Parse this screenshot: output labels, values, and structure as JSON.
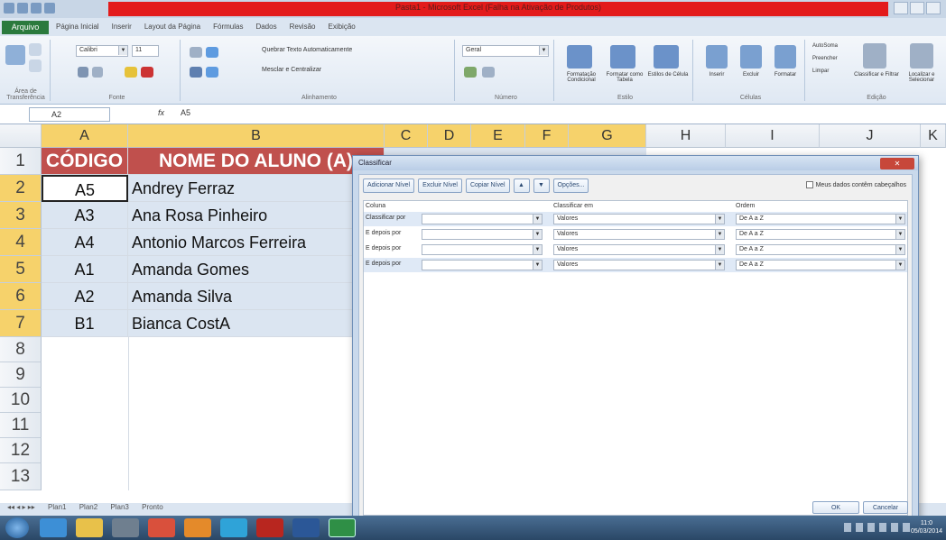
{
  "window": {
    "title": "Pasta1 - Microsoft Excel (Falha na Ativação de Produtos)"
  },
  "menu": {
    "file_tab": "Arquivo",
    "tabs": [
      "Página Inicial",
      "Inserir",
      "Layout da Página",
      "Fórmulas",
      "Dados",
      "Revisão",
      "Exibição"
    ]
  },
  "ribbon": {
    "font_name": "Calibri",
    "font_size": "11",
    "number_format": "Geral",
    "groups": [
      "Área de Transferência",
      "Fonte",
      "Alinhamento",
      "Número",
      "Estilo",
      "Células",
      "Edição"
    ],
    "wrap_text": "Quebrar Texto Automaticamente",
    "merge_center": "Mesclar e Centralizar",
    "buttons": [
      "Formatação Condicional",
      "Formatar como Tabela",
      "Estilos de Célula",
      "Inserir",
      "Excluir",
      "Formatar",
      "AutoSoma",
      "Preencher",
      "Limpar",
      "Classificar e Filtrar",
      "Localizar e Selecionar"
    ]
  },
  "formula_bar": {
    "name_box": "A2",
    "fx": "fx",
    "value": "A5"
  },
  "sheet": {
    "columns": [
      "A",
      "B",
      "C",
      "D",
      "E",
      "F",
      "G",
      "H",
      "I",
      "J",
      "K"
    ],
    "rows": [
      "1",
      "2",
      "3",
      "4",
      "5",
      "6",
      "7",
      "8",
      "9",
      "10",
      "11",
      "12",
      "13"
    ],
    "header_code": "CÓDIGO",
    "header_name": "NOME DO ALUNO (A)",
    "data": [
      {
        "code": "A5",
        "name": "Andrey Ferraz"
      },
      {
        "code": "A3",
        "name": "Ana Rosa Pinheiro"
      },
      {
        "code": "A4",
        "name": "Antonio Marcos Ferreira"
      },
      {
        "code": "A1",
        "name": "Amanda Gomes"
      },
      {
        "code": "A2",
        "name": "Amanda Silva"
      },
      {
        "code": "B1",
        "name": "Bianca CostA"
      }
    ],
    "tabs": [
      "Plan1",
      "Plan2",
      "Plan3"
    ],
    "status": "Pronto"
  },
  "dialog": {
    "title": "Classificar",
    "add_level": "Adicionar Nível",
    "delete_level": "Excluir Nível",
    "copy_level": "Copiar Nível",
    "options": "Opções...",
    "has_headers": "Meus dados contêm cabeçalhos",
    "col_column": "Coluna",
    "col_sort_on": "Classificar em",
    "col_order": "Ordem",
    "rows": [
      {
        "label": "Classificar por",
        "column": "",
        "sort_on": "Valores",
        "order": "De A a Z"
      },
      {
        "label": "E depois por",
        "column": "",
        "sort_on": "Valores",
        "order": "De A a Z"
      },
      {
        "label": "E depois por",
        "column": "",
        "sort_on": "Valores",
        "order": "De A a Z"
      },
      {
        "label": "E depois por",
        "column": "",
        "sort_on": "Valores",
        "order": "De A a Z"
      }
    ],
    "ok": "OK",
    "cancel": "Cancelar"
  },
  "taskbar": {
    "time": "11:0",
    "date": "05/03/2014"
  }
}
